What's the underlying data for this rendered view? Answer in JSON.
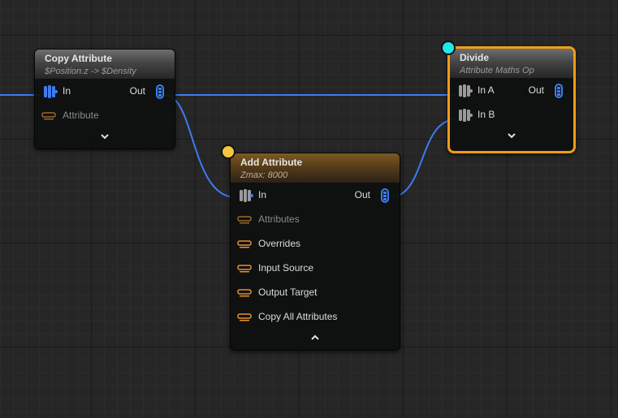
{
  "colors": {
    "wire": "#3c7cf0",
    "data_pin": "#3c7cf0",
    "param_pin": "#e8912c",
    "selection": "#f39c12",
    "divide_dot": "#20e8e8",
    "add_dot": "#f5c542"
  },
  "nodes": {
    "copy_attribute": {
      "title": "Copy Attribute",
      "subtitle": "$Position.z -> $Density",
      "inputs": [
        {
          "label": "In",
          "icon": "data-pin-icon"
        }
      ],
      "output": {
        "label": "Out",
        "icon": "data-pin-icon"
      },
      "params": [
        {
          "label": "Attribute",
          "icon": "param-pin-icon"
        }
      ],
      "toggle": "expand"
    },
    "add_attribute": {
      "title": "Add Attribute",
      "subtitle": "Zmax: 8000",
      "inputs": [
        {
          "label": "In",
          "icon": "data-pin-icon"
        }
      ],
      "output": {
        "label": "Out",
        "icon": "data-pin-icon"
      },
      "params": [
        {
          "label": "Attributes",
          "icon": "param-pin-icon"
        },
        {
          "label": "Overrides",
          "icon": "param-pin-icon"
        },
        {
          "label": "Input Source",
          "icon": "param-pin-icon"
        },
        {
          "label": "Output Target",
          "icon": "param-pin-icon"
        },
        {
          "label": "Copy All Attributes",
          "icon": "param-pin-icon"
        }
      ],
      "toggle": "collapse"
    },
    "divide": {
      "title": "Divide",
      "subtitle": "Attribute Maths Op",
      "inputs": [
        {
          "label": "In A",
          "icon": "data-pin-icon"
        },
        {
          "label": "In B",
          "icon": "data-pin-icon"
        }
      ],
      "output": {
        "label": "Out",
        "icon": "data-pin-icon"
      },
      "selected": true,
      "toggle": "expand"
    }
  }
}
